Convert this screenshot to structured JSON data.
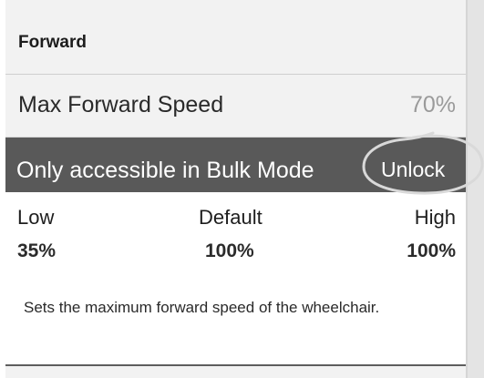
{
  "section": {
    "title": "Forward"
  },
  "setting": {
    "label": "Max Forward Speed",
    "value": "70%"
  },
  "bulk_mode": {
    "message": "Only accessible in Bulk Mode",
    "unlock_label": "Unlock"
  },
  "range": {
    "low_label": "Low",
    "default_label": "Default",
    "high_label": "High",
    "low_value": "35%",
    "default_value": "100%",
    "high_value": "100%"
  },
  "description": "Sets the maximum forward speed of the wheelchair.",
  "colors": {
    "header_bg": "#f2f2f2",
    "bulk_bar_bg": "#595959",
    "value_gray": "#9a9a9a",
    "annotation_stroke": "#d9d9d9"
  }
}
